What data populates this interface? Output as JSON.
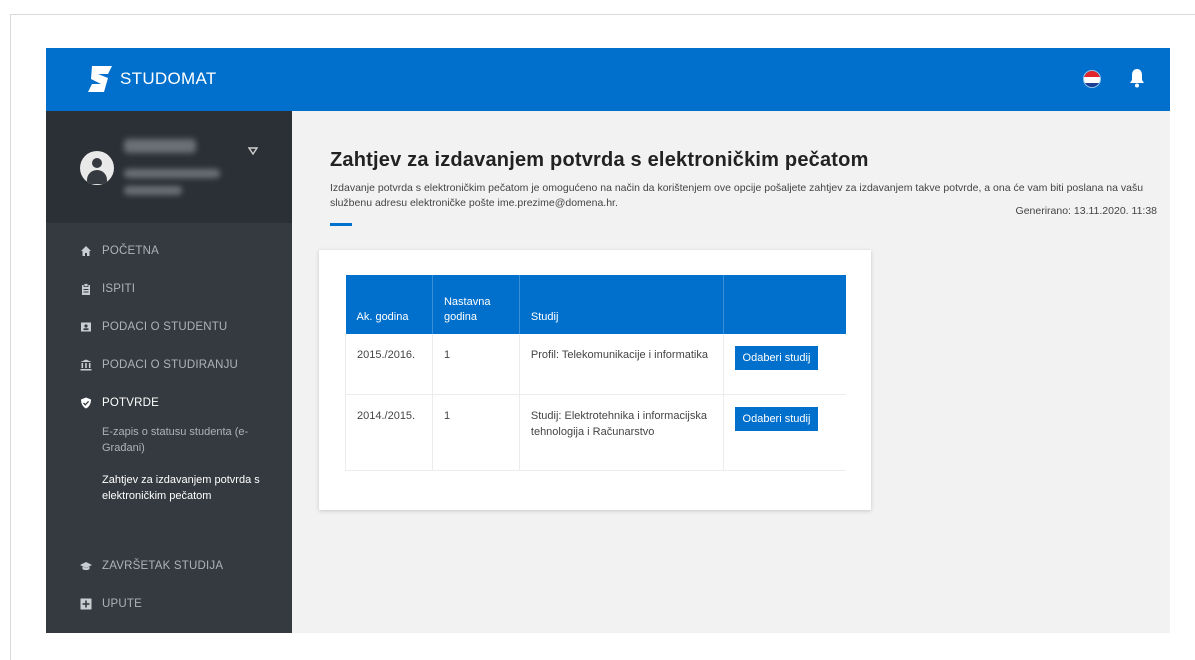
{
  "app": {
    "name": "STUDOMAT"
  },
  "colors": {
    "primary": "#0070cc",
    "sidebar": "#343a40",
    "background": "#f2f2f2"
  },
  "header": {
    "icons": [
      "croatia-flag-icon",
      "bell-icon"
    ]
  },
  "sidebar": {
    "items": [
      {
        "label": "POČETNA",
        "icon": "home-icon"
      },
      {
        "label": "ISPITI",
        "icon": "clipboard-icon"
      },
      {
        "label": "PODACI O STUDENTU",
        "icon": "id-card-icon"
      },
      {
        "label": "PODACI O STUDIRANJU",
        "icon": "institution-icon"
      },
      {
        "label": "POTVRDE",
        "icon": "shield-check-icon"
      },
      {
        "label": "ZAVRŠETAK STUDIJA",
        "icon": "graduation-cap-icon"
      },
      {
        "label": "UPUTE",
        "icon": "plus-square-icon"
      }
    ],
    "subitems": [
      {
        "label": "E-zapis o statusu studenta (e-Građani)"
      },
      {
        "label": "Zahtjev za izdavanjem potvrda s elektroničkim pečatom"
      }
    ]
  },
  "main": {
    "title": "Zahtjev za izdavanjem potvrda s elektroničkim pečatom",
    "description": "Izdavanje potvrda s elektroničkim pečatom je omogućeno na način da korištenjem ove opcije pošaljete zahtjev za izdavanjem takve potvrde, a ona će vam biti poslana na vašu službenu adresu elektroničke pošte ime.prezime@domena.hr.",
    "generated": "Generirano: 13.11.2020. 11:38",
    "table": {
      "headers": [
        "Ak. godina",
        "Nastavna godina",
        "Studij",
        ""
      ],
      "rows": [
        {
          "ak_godina": "2015./2016.",
          "nastavna_godina": "1",
          "studij": "Profil: Telekomunikacije i informatika",
          "action": "Odaberi studij"
        },
        {
          "ak_godina": "2014./2015.",
          "nastavna_godina": "1",
          "studij": "Studij: Elektrotehnika i informacijska tehnologija i Računarstvo",
          "action": "Odaberi studij"
        }
      ]
    }
  }
}
